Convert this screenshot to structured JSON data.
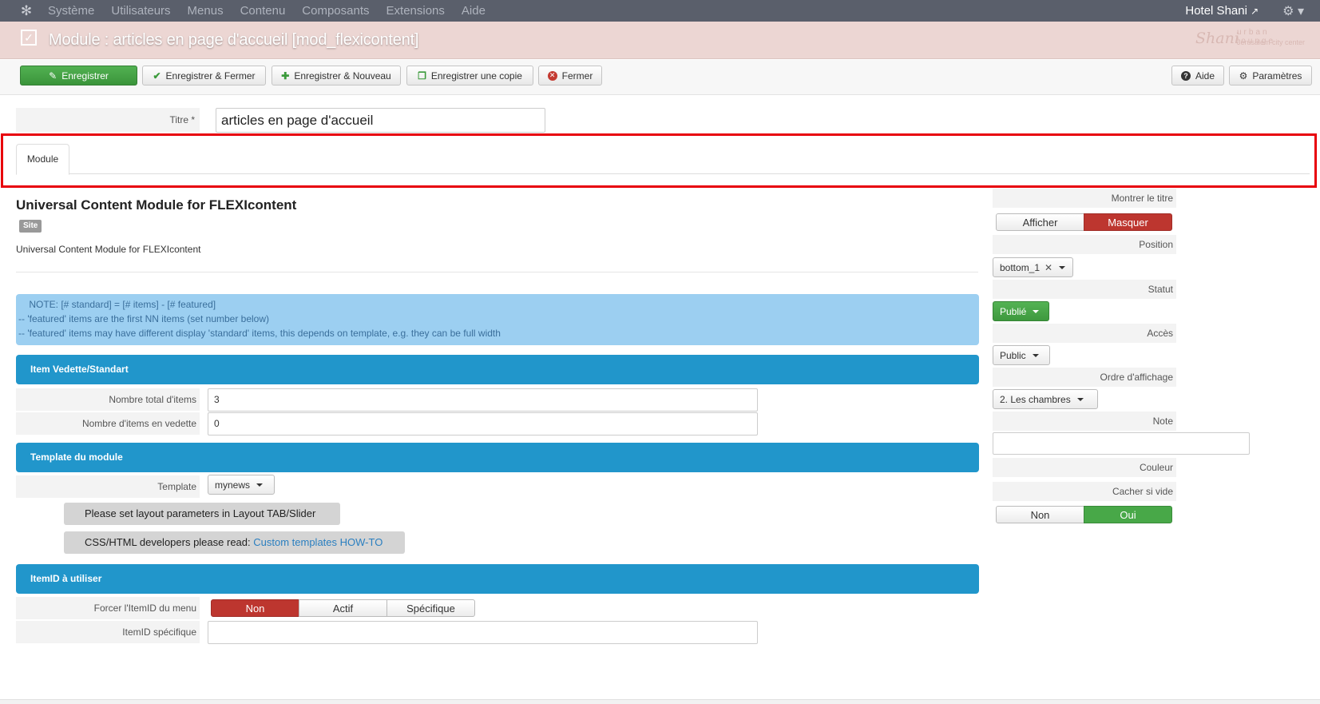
{
  "navbar": {
    "logo_icon": "joomla-icon",
    "menu": [
      "Système",
      "Utilisateurs",
      "Menus",
      "Contenu",
      "Composants",
      "Extensions",
      "Aide"
    ],
    "site_name": "Hotel Shani",
    "site_link_icon": "external-link-icon",
    "settings_icon": "gear-icon"
  },
  "titlebar": {
    "icon": "checkbox-icon",
    "title": "Module : articles en page d'accueil [mod_flexicontent]",
    "brand": {
      "name": "Shani",
      "tagline": "urban lounge",
      "subtagline": "Jerusalem city center"
    }
  },
  "toolbar": {
    "save": "Enregistrer",
    "save_close": "Enregistrer & Fermer",
    "save_new": "Enregistrer & Nouveau",
    "save_copy": "Enregistrer une copie",
    "close": "Fermer",
    "help": "Aide",
    "options": "Paramètres"
  },
  "title_field": {
    "label": "Titre *",
    "value": "articles en page d'accueil"
  },
  "tabs": [
    {
      "label": "Module"
    }
  ],
  "module": {
    "name": "Universal Content Module for FLEXIcontent",
    "badge": "Site",
    "description": "Universal Content Module for FLEXIcontent"
  },
  "info": {
    "lines": [
      "    NOTE: [# standard] = [# items] - [# featured]",
      "-- 'featured' items are the first NN items (set number below)",
      "-- 'featured' items may have different display 'standard' items, this depends on template, e.g. they can be full width"
    ]
  },
  "sections": {
    "featured": {
      "title": "Item Vedette/Standart",
      "total_label": "Nombre total d'items",
      "total_value": "3",
      "featured_label": "Nombre d'items en vedette",
      "featured_value": "0"
    },
    "template": {
      "title": "Template du module",
      "label": "Template",
      "value": "mynews",
      "note1": "Please set layout parameters in Layout TAB/Slider",
      "note2_prefix": "CSS/HTML developers please read:",
      "note2_link": "Custom templates HOW-TO"
    },
    "itemid": {
      "title": "ItemID à utiliser",
      "force_label": "Forcer l'ItemID du menu",
      "options": [
        "Non",
        "Actif",
        "Spécifique"
      ],
      "selected": "Non",
      "specific_label": "ItemID spécifique",
      "specific_value": ""
    }
  },
  "sidebar": {
    "show_title_label": "Montrer le titre",
    "show_title_options": [
      "Afficher",
      "Masquer"
    ],
    "show_title_selected": "Masquer",
    "position_label": "Position",
    "position_value": "bottom_1",
    "status_label": "Statut",
    "status_value": "Publié",
    "access_label": "Accès",
    "access_value": "Public",
    "order_label": "Ordre d'affichage",
    "order_value": "2. Les chambres",
    "note_label": "Note",
    "note_value": "",
    "color_label": "Couleur",
    "hide_empty_label": "Cacher si vide",
    "hide_empty_options": [
      "Non",
      "Oui"
    ],
    "hide_empty_selected": "Oui"
  },
  "colors": {
    "navbar": "#5a5f6b",
    "titlebar": "#ecd6d3",
    "save_green": "#46a546",
    "section_blue": "#2196cb",
    "info_blue": "#9ccff1",
    "active_red": "#bd362f",
    "active_green": "#48a848",
    "highlight_red": "#e8000b"
  }
}
